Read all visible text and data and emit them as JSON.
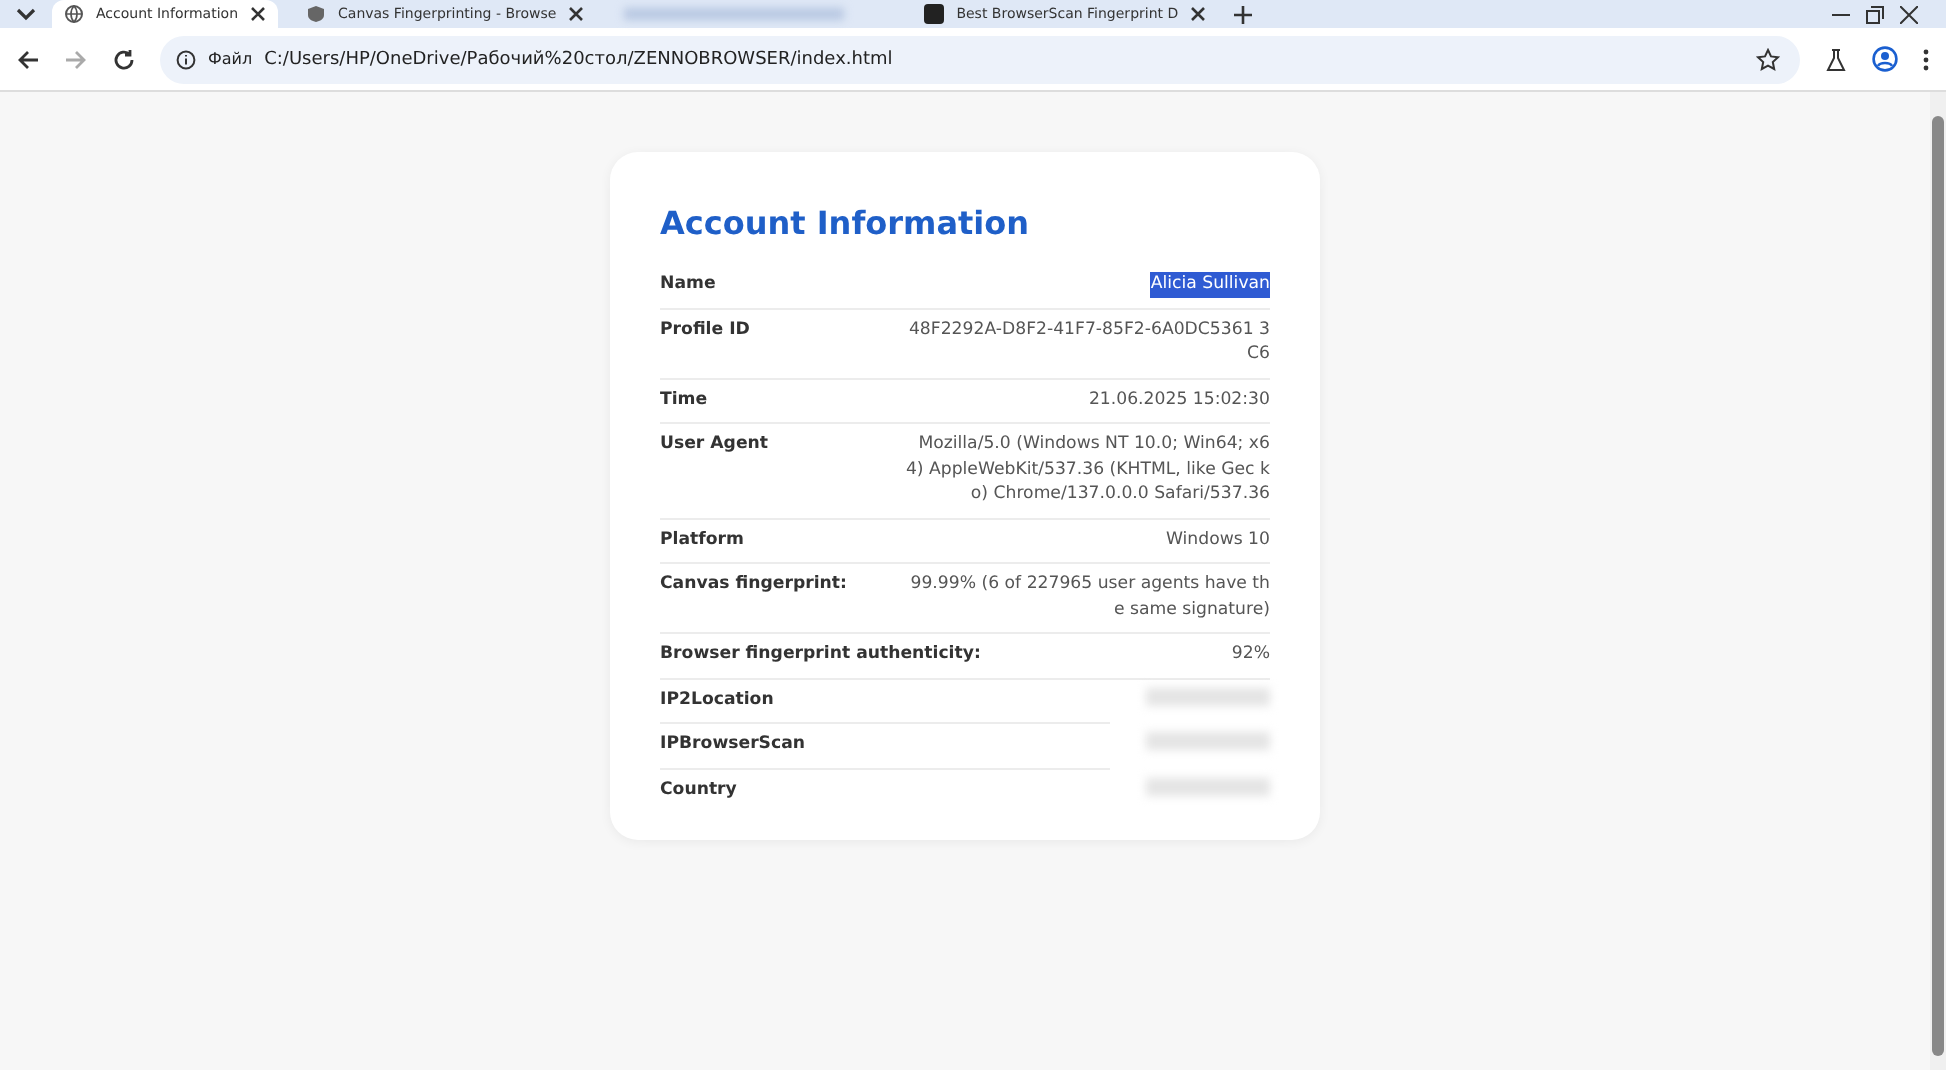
{
  "tabs": [
    {
      "label": "Account Information",
      "selected": true,
      "kind": "globe"
    },
    {
      "label": "Canvas Fingerprinting - Browse",
      "selected": false,
      "kind": "shield"
    },
    {
      "selected": false,
      "kind": "blurred"
    },
    {
      "label": "Best BrowserScan Fingerprint D",
      "selected": false,
      "kind": "logo"
    }
  ],
  "address_bar": {
    "badge": "Файл",
    "url": "C:/Users/HP/OneDrive/Рабочий%20стол/ZENNOBROWSER/index.html"
  },
  "card": {
    "title": "Account Information",
    "rows": [
      {
        "label": "Name",
        "value": "Alicia Sullivan",
        "kind": "text",
        "highlighted": true
      },
      {
        "label": "Profile ID",
        "value": "48F2292A-D8F2-41F7-85F2-6A0DC5361 3C6",
        "kind": "text",
        "highlighted": false
      },
      {
        "label": "Time",
        "value": "21.06.2025 15:02:30",
        "kind": "text",
        "highlighted": false
      },
      {
        "label": "User Agent",
        "value": "Mozilla/5.0 (Windows NT 10.0; Win64; x6 4) AppleWebKit/537.36 (KHTML, like Gec ko) Chrome/137.0.0.0 Safari/537.36",
        "kind": "text",
        "highlighted": false
      },
      {
        "label": "Platform",
        "value": "Windows 10",
        "kind": "text",
        "highlighted": false
      },
      {
        "label": "Canvas fingerprint:",
        "value": "99.99% (6 of 227965 user agents have th e same signature)",
        "kind": "text",
        "highlighted": false
      },
      {
        "label": "Browser fingerprint authenticity:",
        "value": "92%",
        "kind": "text",
        "highlighted": false
      },
      {
        "label": "IP2Location",
        "kind": "blurred"
      },
      {
        "label": "IPBrowserScan",
        "kind": "blurred"
      },
      {
        "label": "Country",
        "kind": "blurred"
      }
    ]
  }
}
